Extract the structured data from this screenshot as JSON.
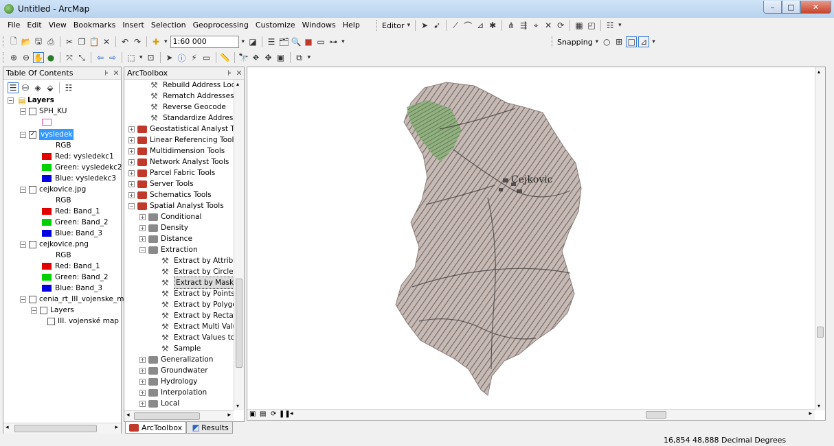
{
  "window": {
    "title": "Untitled - ArcMap",
    "min": "–",
    "max": "□",
    "close": "✕"
  },
  "menus": [
    "File",
    "Edit",
    "View",
    "Bookmarks",
    "Insert",
    "Selection",
    "Geoprocessing",
    "Customize",
    "Windows",
    "Help"
  ],
  "toolbar": {
    "scale": "1:60 000",
    "editor": "Editor",
    "snapping": "Snapping"
  },
  "toc": {
    "title": "Table Of Contents",
    "pin": "⊡ ✕",
    "items": [
      {
        "label": "Layers",
        "level": 0
      },
      {
        "label": "SPH_KU",
        "level": 1
      },
      {
        "label": "vysledek",
        "level": 1
      },
      {
        "label": "RGB",
        "level": 2
      },
      {
        "label": "Red:   vysledekc1",
        "level": 2
      },
      {
        "label": "Green: vysledekc2",
        "level": 2
      },
      {
        "label": "Blue:  vysledekc3",
        "level": 2
      },
      {
        "label": "cejkovice.jpg",
        "level": 1
      },
      {
        "label": "RGB",
        "level": 2
      },
      {
        "label": "Red:   Band_1",
        "level": 2
      },
      {
        "label": "Green: Band_2",
        "level": 2
      },
      {
        "label": "Blue:  Band_3",
        "level": 2
      },
      {
        "label": "cejkovice.png",
        "level": 1
      },
      {
        "label": "RGB",
        "level": 2
      },
      {
        "label": "Red:   Band_1",
        "level": 2
      },
      {
        "label": "Green: Band_2",
        "level": 2
      },
      {
        "label": "Blue:  Band_3",
        "level": 2
      },
      {
        "label": "cenia_rt_III_vojenske_m",
        "level": 1
      },
      {
        "label": "Layers",
        "level": 2
      },
      {
        "label": "III. vojenské map",
        "level": 3
      }
    ],
    "colors": {
      "red": "#e00000",
      "green": "#00d000",
      "blue": "#0000e0",
      "pink": "#e04db0"
    }
  },
  "toolbox": {
    "title": "ArcToolbox",
    "items": [
      {
        "label": "Rebuild Address Locat",
        "kind": "tool",
        "level": 2
      },
      {
        "label": "Rematch Addresses",
        "kind": "tool",
        "level": 2
      },
      {
        "label": "Reverse Geocode",
        "kind": "tool",
        "level": 2
      },
      {
        "label": "Standardize Addresses",
        "kind": "tool",
        "level": 2
      },
      {
        "label": "Geostatistical Analyst Toc",
        "kind": "box",
        "level": 0
      },
      {
        "label": "Linear Referencing Tools",
        "kind": "box",
        "level": 0
      },
      {
        "label": "Multidimension Tools",
        "kind": "box",
        "level": 0
      },
      {
        "label": "Network Analyst Tools",
        "kind": "box",
        "level": 0
      },
      {
        "label": "Parcel Fabric Tools",
        "kind": "box",
        "level": 0
      },
      {
        "label": "Server Tools",
        "kind": "box",
        "level": 0
      },
      {
        "label": "Schematics Tools",
        "kind": "box",
        "level": 0
      },
      {
        "label": "Spatial Analyst Tools",
        "kind": "box",
        "level": 0
      },
      {
        "label": "Conditional",
        "kind": "set",
        "level": 1
      },
      {
        "label": "Density",
        "kind": "set",
        "level": 1
      },
      {
        "label": "Distance",
        "kind": "set",
        "level": 1
      },
      {
        "label": "Extraction",
        "kind": "set",
        "level": 1
      },
      {
        "label": "Extract by Attribut",
        "kind": "tool",
        "level": 2
      },
      {
        "label": "Extract by Circle",
        "kind": "tool",
        "level": 2
      },
      {
        "label": "Extract by Mask",
        "kind": "tool",
        "level": 2
      },
      {
        "label": "Extract by Points",
        "kind": "tool",
        "level": 2
      },
      {
        "label": "Extract by Polygor",
        "kind": "tool",
        "level": 2
      },
      {
        "label": "Extract by Rectang",
        "kind": "tool",
        "level": 2
      },
      {
        "label": "Extract Multi Value",
        "kind": "tool",
        "level": 2
      },
      {
        "label": "Extract Values to P",
        "kind": "tool",
        "level": 2
      },
      {
        "label": "Sample",
        "kind": "tool",
        "level": 2
      },
      {
        "label": "Generalization",
        "kind": "set",
        "level": 1
      },
      {
        "label": "Groundwater",
        "kind": "set",
        "level": 1
      },
      {
        "label": "Hydrology",
        "kind": "set",
        "level": 1
      },
      {
        "label": "Interpolation",
        "kind": "set",
        "level": 1
      },
      {
        "label": "Local",
        "kind": "set",
        "level": 1
      }
    ],
    "tabs": [
      "ArcToolbox",
      "Results"
    ]
  },
  "map": {
    "labels": [
      "Cejkovic"
    ]
  },
  "status": {
    "coords": "16,854  48,888 Decimal Degrees"
  }
}
